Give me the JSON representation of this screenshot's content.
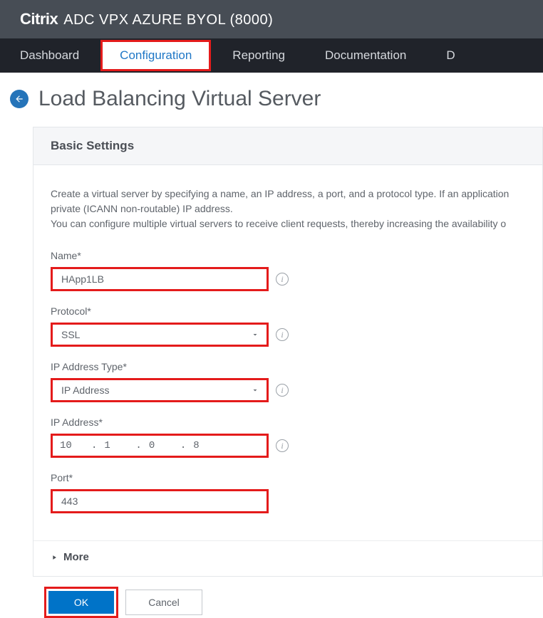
{
  "header": {
    "brand": "Citrix",
    "product": "ADC VPX AZURE BYOL (8000)"
  },
  "tabs": {
    "dashboard": "Dashboard",
    "configuration": "Configuration",
    "reporting": "Reporting",
    "documentation": "Documentation",
    "last_partial": "D"
  },
  "page": {
    "title": "Load Balancing Virtual Server"
  },
  "panel": {
    "title": "Basic Settings",
    "description_line1": "Create a virtual server by specifying a name, an IP address, a port, and a protocol type. If an application",
    "description_line2": "private (ICANN non-routable) IP address.",
    "description_line3": "You can configure multiple virtual servers to receive client requests, thereby increasing the availability o"
  },
  "fields": {
    "name": {
      "label": "Name*",
      "value": "HApp1LB"
    },
    "protocol": {
      "label": "Protocol*",
      "value": "SSL"
    },
    "ip_type": {
      "label": "IP Address Type*",
      "value": "IP Address"
    },
    "ip_address": {
      "label": "IP Address*",
      "seg1": "10",
      "seg2": "1",
      "seg3": "0",
      "seg4": "8"
    },
    "port": {
      "label": "Port*",
      "value": "443"
    }
  },
  "more": {
    "label": "More"
  },
  "buttons": {
    "ok": "OK",
    "cancel": "Cancel"
  },
  "icons": {
    "info": "i",
    "dot": "."
  }
}
